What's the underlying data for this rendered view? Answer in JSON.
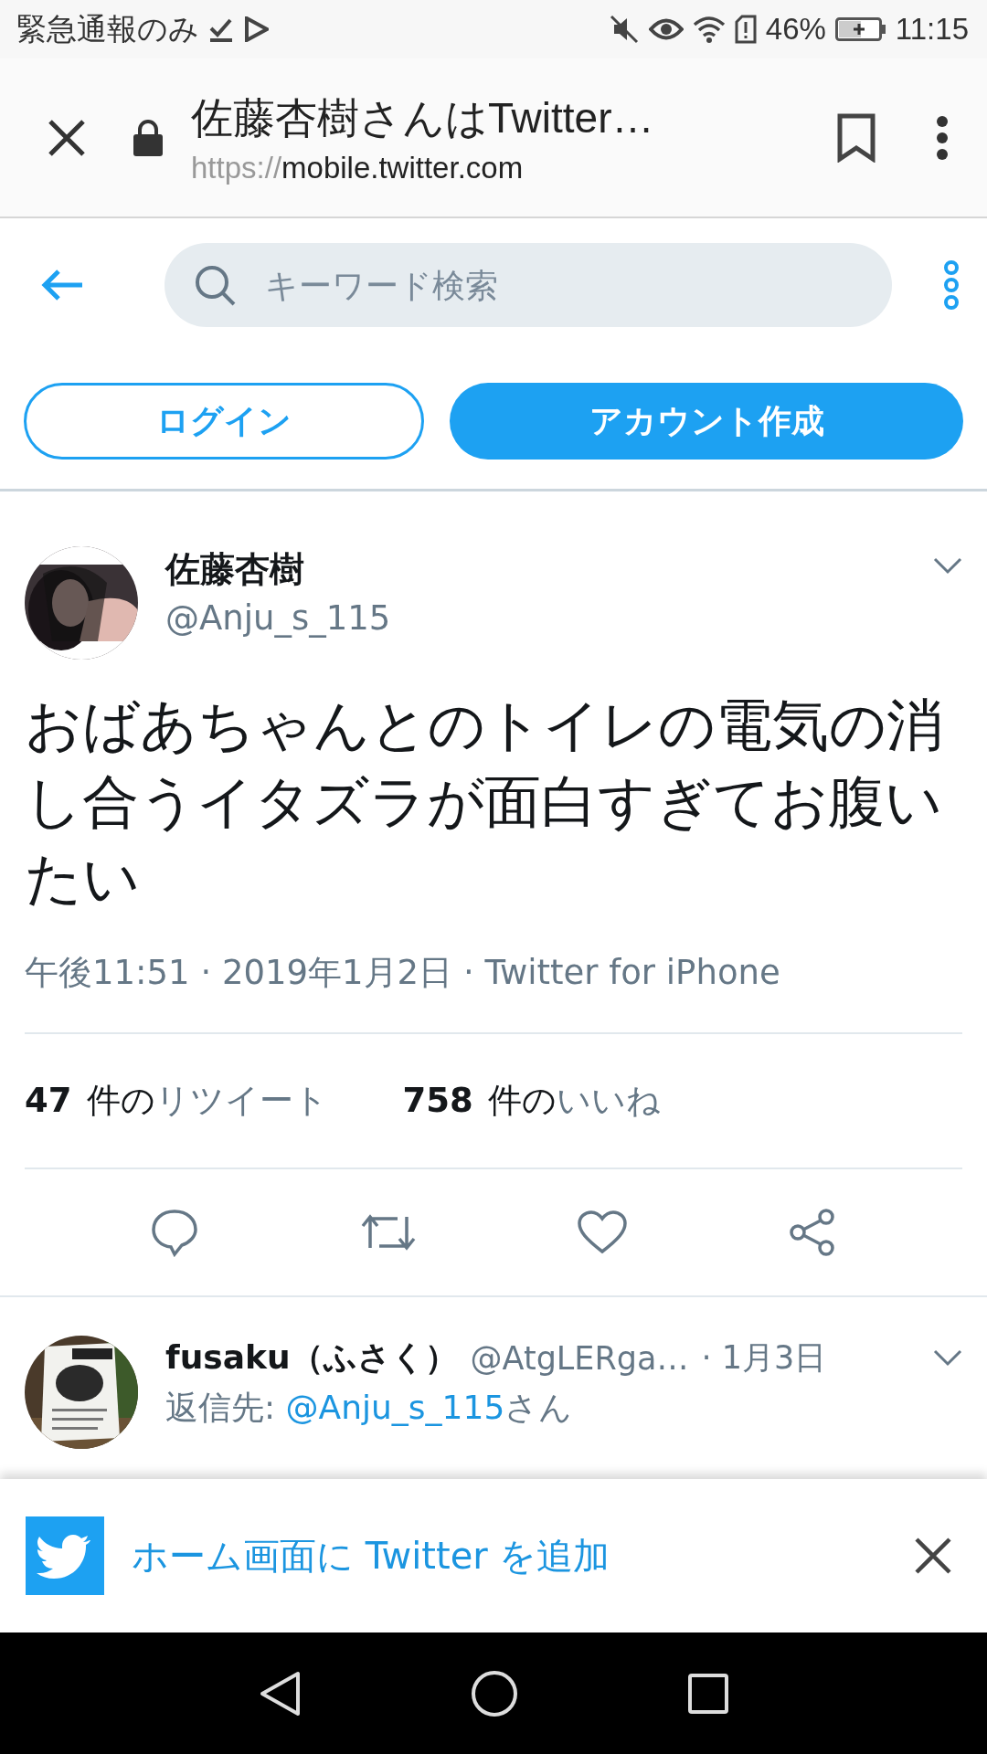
{
  "status_bar": {
    "left_text": "緊急通報のみ",
    "battery": "46%",
    "time": "11:15"
  },
  "browser_bar": {
    "title": "佐藤杏樹さんはTwitter…",
    "url_scheme": "https://",
    "url_host": "mobile.twitter.com"
  },
  "header": {
    "search_placeholder": "キーワード検索",
    "login": "ログイン",
    "signup": "アカウント作成"
  },
  "tweet": {
    "name": "佐藤杏樹",
    "handle": "@Anju_s_115",
    "text": "おばあちゃんとのトイレの電気の消し合うイタズラが面白すぎてお腹いたい",
    "meta": "午後11:51 · 2019年1月2日 · Twitter for iPhone",
    "stats": [
      {
        "count": "47",
        "unit": "件の",
        "label": "リツイート"
      },
      {
        "count": "758",
        "unit": "件の",
        "label": "いいね"
      }
    ]
  },
  "reply": {
    "name": "fusaku（ふさく）",
    "handle": "@AtgLERga…",
    "date": "· 1月3日",
    "reply_prefix": "返信先: ",
    "reply_to": "@Anju_s_115",
    "reply_suffix": "さん"
  },
  "banner": {
    "text": "ホーム画面に Twitter を追加"
  }
}
